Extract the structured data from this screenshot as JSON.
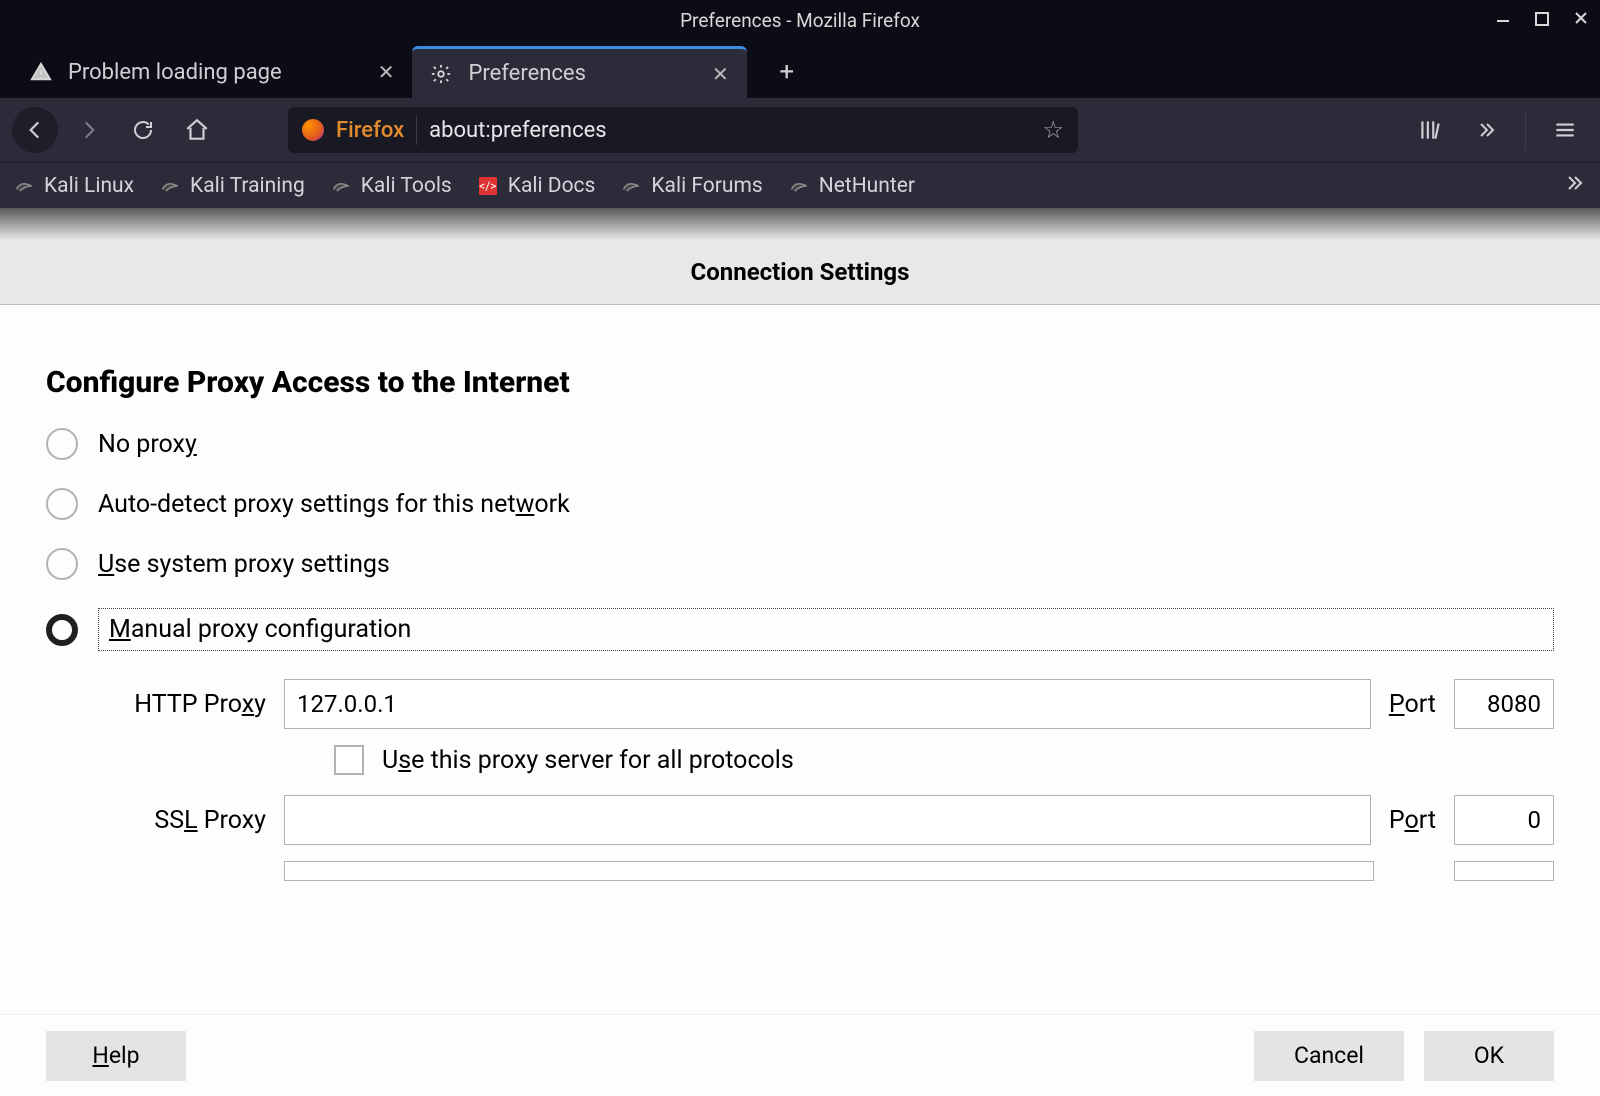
{
  "window": {
    "title": "Preferences - Mozilla Firefox"
  },
  "tabs": [
    {
      "label": "Problem loading page",
      "active": false
    },
    {
      "label": "Preferences",
      "active": true
    }
  ],
  "addressbar": {
    "identity": "Firefox",
    "url": "about:preferences"
  },
  "bookmarks": [
    {
      "label": "Kali Linux"
    },
    {
      "label": "Kali Training"
    },
    {
      "label": "Kali Tools"
    },
    {
      "label": "Kali Docs"
    },
    {
      "label": "Kali Forums"
    },
    {
      "label": "NetHunter"
    }
  ],
  "dialog": {
    "title": "Connection Settings",
    "section_title": "Configure Proxy Access to the Internet",
    "options": {
      "no_proxy": "No proxy",
      "auto_detect": "Auto-detect proxy settings for this network",
      "system": "Use system proxy settings",
      "manual": "Manual proxy configuration"
    },
    "fields": {
      "http_label": "HTTP Proxy",
      "http_value": "127.0.0.1",
      "http_port_label": "Port",
      "http_port_value": "8080",
      "use_all_label": "Use this proxy server for all protocols",
      "ssl_label": "SSL Proxy",
      "ssl_value": "",
      "ssl_port_label": "Port",
      "ssl_port_value": "0"
    },
    "buttons": {
      "help": "Help",
      "cancel": "Cancel",
      "ok": "OK"
    }
  }
}
